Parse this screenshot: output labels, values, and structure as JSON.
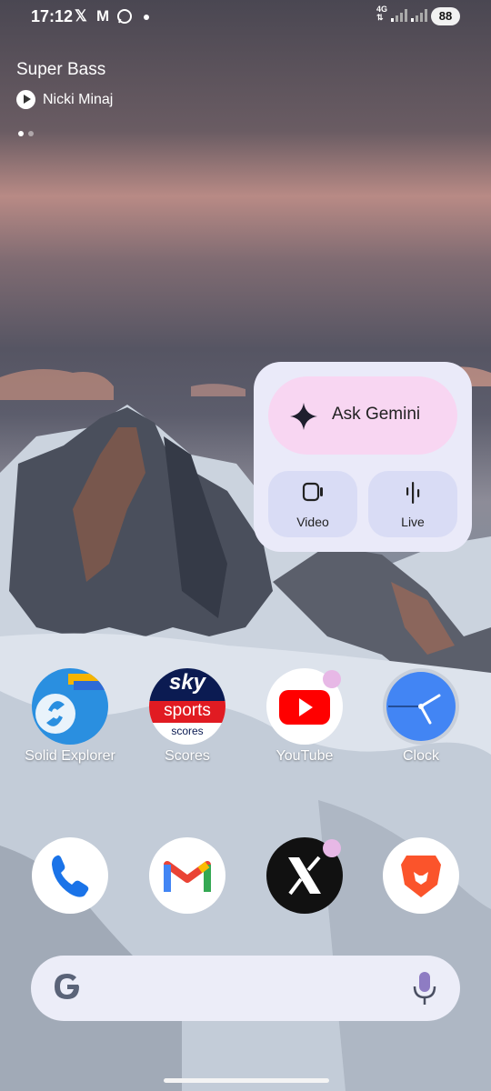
{
  "status_bar": {
    "time": "17:12",
    "notifications": [
      "X",
      "M",
      "whatsapp-icon"
    ],
    "network_type": "4G",
    "battery": "88"
  },
  "media": {
    "title": "Super Bass",
    "artist": "Nicki Minaj"
  },
  "gemini_widget": {
    "ask_label": "Ask Gemini",
    "video_label": "Video",
    "live_label": "Live"
  },
  "apps_row1": [
    {
      "label": "Solid Explorer"
    },
    {
      "label": "Scores"
    },
    {
      "label": "YouTube"
    },
    {
      "label": "Clock"
    }
  ],
  "sky_sports": {
    "sky": "sky",
    "sports": "sports",
    "scores": "scores"
  },
  "colors": {
    "gemini_bg": "#eaeaf9",
    "ask_pill": "#f8d6f2",
    "gemini_buttons": "#d9dcf5",
    "search_bar": "#ecedf8",
    "badge": "#e7b8e6"
  }
}
